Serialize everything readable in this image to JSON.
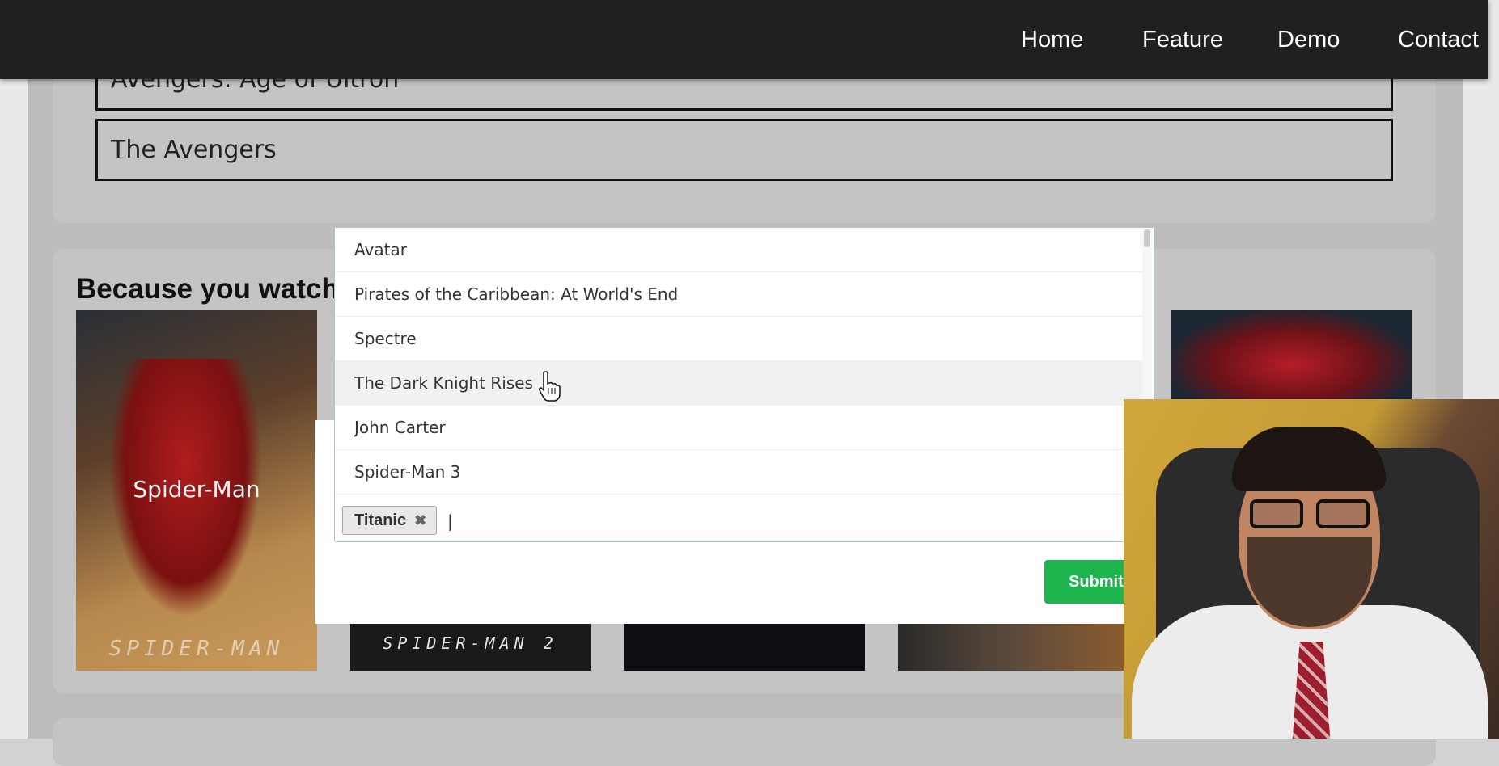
{
  "navbar": {
    "links": [
      "Home",
      "Feature",
      "Demo",
      "Contact"
    ]
  },
  "previous_list": {
    "items": [
      "Avengers: Age of Ultron",
      "The Avengers"
    ]
  },
  "recommendations": {
    "title": "Because you watche",
    "posters": [
      {
        "title": "Spider-Man",
        "logo": "SPIDER-MAN"
      },
      {
        "logo": "SPIDER-MAN 2"
      }
    ]
  },
  "movie_select": {
    "options": [
      "Avatar",
      "Pirates of the Caribbean: At World's End",
      "Spectre",
      "The Dark Knight Rises",
      "John Carter",
      "Spider-Man 3"
    ],
    "highlighted_index": 3,
    "selected_tags": [
      "Titanic"
    ],
    "tag_remove_glyph": "✖",
    "caret": "|"
  },
  "submit_label": "Submit",
  "colors": {
    "navbar": "#202020",
    "submit": "#1fb54e",
    "dropdown_border": "#a9c7cf"
  }
}
